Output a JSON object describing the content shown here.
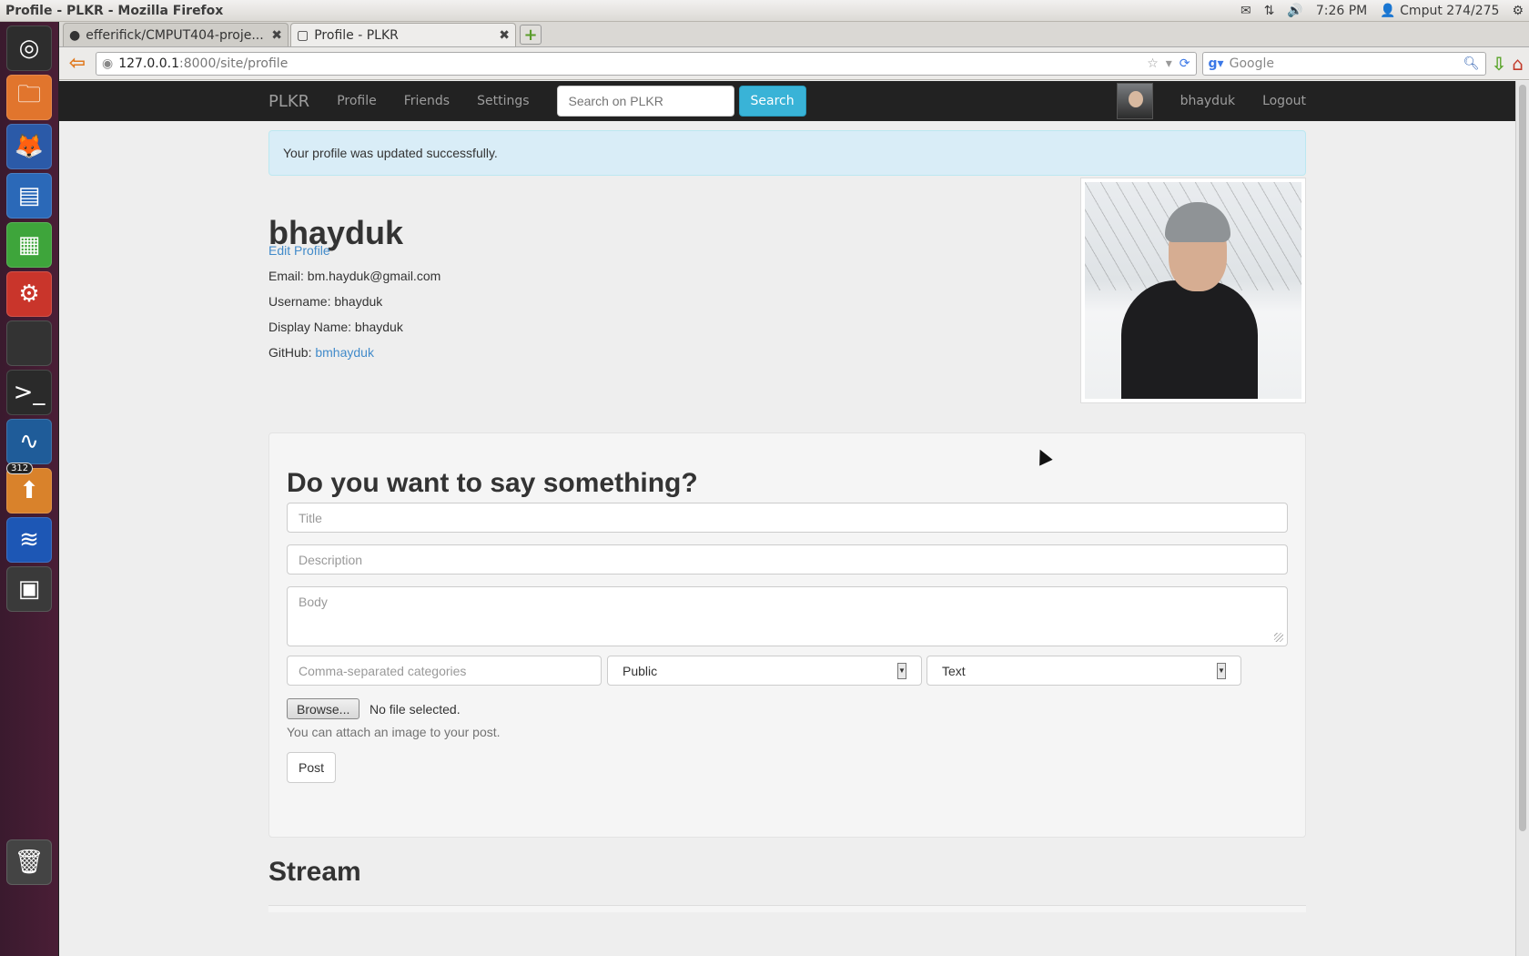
{
  "window": {
    "title": "Profile - PLKR - Mozilla Firefox",
    "tray": {
      "mail": "✉",
      "network": "⇅",
      "volume": "🔊",
      "time": "7:26 PM",
      "user": "Cmput 274/275",
      "gear": "⚙"
    }
  },
  "launcher": {
    "items": [
      {
        "name": "dash",
        "glyph": "◎",
        "color": "#2d2d2d"
      },
      {
        "name": "files",
        "glyph": "🗀",
        "color": "#e1752d"
      },
      {
        "name": "firefox",
        "glyph": "🦊",
        "color": "#2b5aa8"
      },
      {
        "name": "writer",
        "glyph": "▤",
        "color": "#2b69b8"
      },
      {
        "name": "calc",
        "glyph": "▦",
        "color": "#3ea53b"
      },
      {
        "name": "system-settings",
        "glyph": "⚙",
        "color": "#c9352b"
      },
      {
        "name": "blank-app",
        "glyph": " ",
        "color": "#333333"
      },
      {
        "name": "terminal",
        "glyph": ">_",
        "color": "#2a2a2a"
      },
      {
        "name": "wireshark",
        "glyph": "∿",
        "color": "#1f5c99"
      },
      {
        "name": "update-manager",
        "glyph": "⬆",
        "color": "#d9822b",
        "badge": "312"
      },
      {
        "name": "java-app",
        "glyph": "≋",
        "color": "#1d57b5"
      },
      {
        "name": "workspaces",
        "glyph": "▣",
        "color": "#3a3a3a"
      },
      {
        "name": "trash",
        "glyph": "🗑",
        "color": "#444444"
      }
    ]
  },
  "browser": {
    "tabs": [
      {
        "label": "efferifick/CMPUT404-proje...",
        "active": false
      },
      {
        "label": "Profile - PLKR",
        "active": true
      }
    ],
    "url_host": "127.0.0.1",
    "url_path": ":8000/site/profile",
    "search_placeholder": "Google"
  },
  "site": {
    "brand": "PLKR",
    "nav": [
      "Profile",
      "Friends",
      "Settings"
    ],
    "search_placeholder": "Search on PLKR",
    "search_button": "Search",
    "user": "bhayduk",
    "logout": "Logout"
  },
  "alert": "Your profile was updated successfully.",
  "profile": {
    "username": "bhayduk",
    "edit_link": "Edit Profile",
    "email_line": "Email: bm.hayduk@gmail.com",
    "username_line": "Username: bhayduk",
    "display_name_line": "Display Name: bhayduk",
    "github_label": "GitHub: ",
    "github_link": "bmhayduk"
  },
  "post_form": {
    "heading": "Do you want to say something?",
    "title_placeholder": "Title",
    "description_placeholder": "Description",
    "body_placeholder": "Body",
    "categories_placeholder": "Comma-separated categories",
    "visibility": "Public",
    "content_type": "Text",
    "browse_label": "Browse...",
    "no_file": "No file selected.",
    "help": "You can attach an image to your post.",
    "post_button": "Post"
  },
  "stream_heading": "Stream"
}
